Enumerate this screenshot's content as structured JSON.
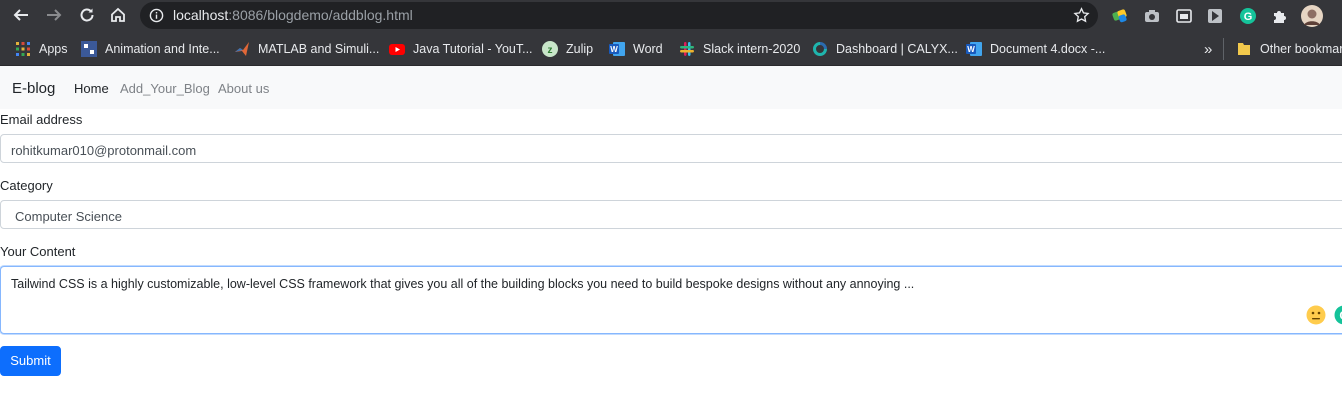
{
  "browser": {
    "url_host": "localhost",
    "url_path": ":8086/blogdemo/addblog.html",
    "bookmarks": [
      {
        "label": "Apps",
        "icon": "apps-grid-icon"
      },
      {
        "label": "Animation and Inte...",
        "icon": "animation-bookmark-icon"
      },
      {
        "label": "MATLAB and Simuli...",
        "icon": "matlab-icon"
      },
      {
        "label": "Java Tutorial - YouT...",
        "icon": "youtube-icon"
      },
      {
        "label": "Zulip",
        "icon": "zulip-icon"
      },
      {
        "label": "Word",
        "icon": "word-icon"
      },
      {
        "label": "Slack intern-2020",
        "icon": "slack-icon"
      },
      {
        "label": "Dashboard | CALYX...",
        "icon": "calyx-icon"
      },
      {
        "label": "Document 4.docx -...",
        "icon": "word-icon"
      }
    ],
    "overflow_label": "»",
    "other_bookmarks": "Other bookmarks"
  },
  "navbar": {
    "brand": "E-blog",
    "links": [
      "Home",
      "Add_Your_Blog",
      "About us"
    ]
  },
  "form": {
    "email_label": "Email address",
    "email_value": "rohitkumar010@protonmail.com",
    "category_label": "Category",
    "category_value": "Computer Science",
    "content_label": "Your Content",
    "content_value": "Tailwind CSS is a highly customizable, low-level CSS framework that gives you all of the building blocks you need to build bespoke designs without any annoying ...",
    "submit_label": "Submit"
  },
  "colors": {
    "chrome_bg": "#35363a",
    "omnibox_bg": "#202124",
    "primary": "#0d6efd",
    "navbar_bg": "#f8f9fa"
  }
}
